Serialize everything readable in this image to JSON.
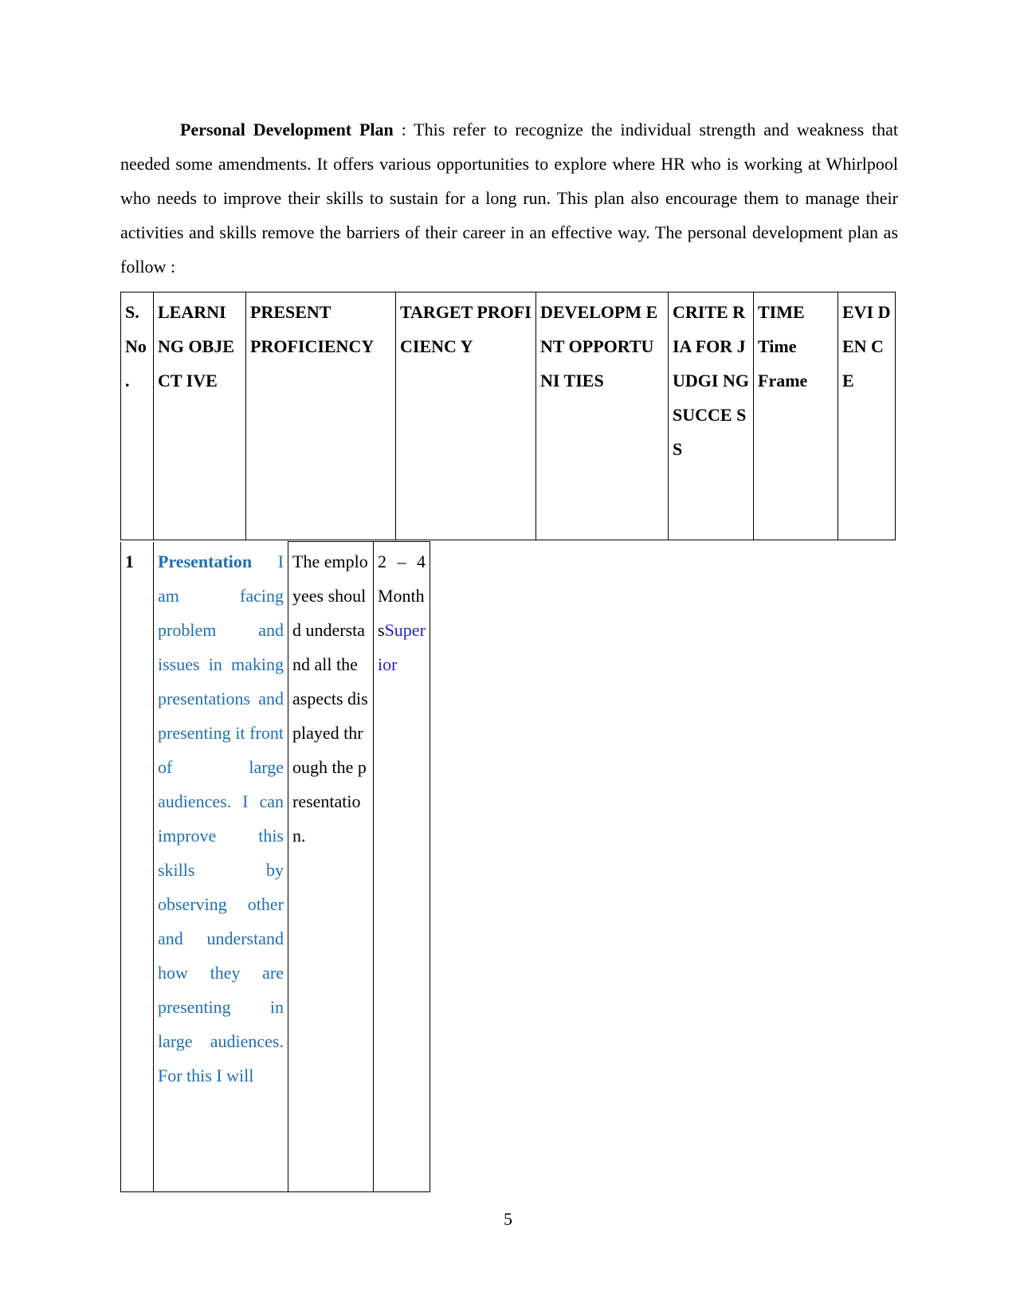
{
  "intro": {
    "heading": "Personal Development Plan",
    "text": " : This refer to recognize the individual strength and weakness that needed some amendments.  It offers various opportunities to explore where HR who is working at  Whirlpool who  needs to improve their skills to sustain for a long run. This plan also encourage them to manage their activities and skills remove the barriers of their career in an effective way. The personal development plan as follow :"
  },
  "table": {
    "headers": [
      "S. No .",
      "LEARNI NG OBJECT IVE",
      "PRESENT PROFICIENCY",
      "TARGET PROFICIENC Y",
      "DEVELOPM ENT OPPORTUNI TIES",
      "CRITE RIA FOR JUDGI NG SUCCE SS",
      "TIME Time Frame",
      "EVI DEN CE"
    ],
    "rows": [
      {
        "sno": "1",
        "objective_title": "Presentation",
        "objective_text": " I am facing problem and issues in making presentations and presenting it front of large audiences. I can improve this skills by observing other and understand how they are presenting in large audiences. For this I will",
        "proficiency": "The employees should understand all the aspects displayed through the presentation.",
        "time_prefix": "2 – 4 Months",
        "time_suffix": "Superior"
      }
    ]
  },
  "footer": {
    "page_number": "5"
  }
}
